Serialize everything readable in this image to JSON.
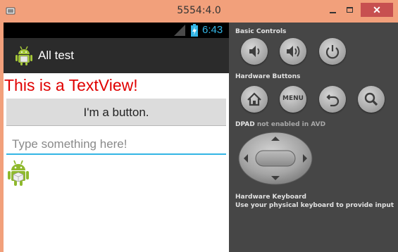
{
  "window": {
    "title": "5554:4.0",
    "minimize_icon": "minimize-icon",
    "maximize_icon": "maximize-icon",
    "close_glyph": "✕"
  },
  "status_bar": {
    "time": "6:43",
    "signal_icon": "signal-icon",
    "battery_icon": "battery-charging-icon",
    "time_color": "#33b5e5"
  },
  "action_bar": {
    "title": "All test",
    "icon": "android-icon"
  },
  "content": {
    "textview": "This is a TextView!",
    "textview_color": "#e00000",
    "button_label": "I'm a button.",
    "edit_placeholder": "Type something here!",
    "edit_value": "",
    "accent_color": "#33b5e5",
    "image_icon": "android-robot-icon"
  },
  "panel": {
    "basic_controls_label": "Basic Controls",
    "hardware_buttons_label": "Hardware Buttons",
    "dpad_label": "DPAD",
    "dpad_note": "not enabled in AVD",
    "keyboard_label": "Hardware Keyboard",
    "keyboard_note": "Use your physical keyboard to provide input",
    "menu_label": "MENU",
    "basic_buttons": [
      "volume-down-icon",
      "volume-up-icon",
      "power-icon"
    ],
    "hardware_buttons": [
      "home-icon",
      "menu-icon",
      "back-icon",
      "search-icon"
    ]
  }
}
